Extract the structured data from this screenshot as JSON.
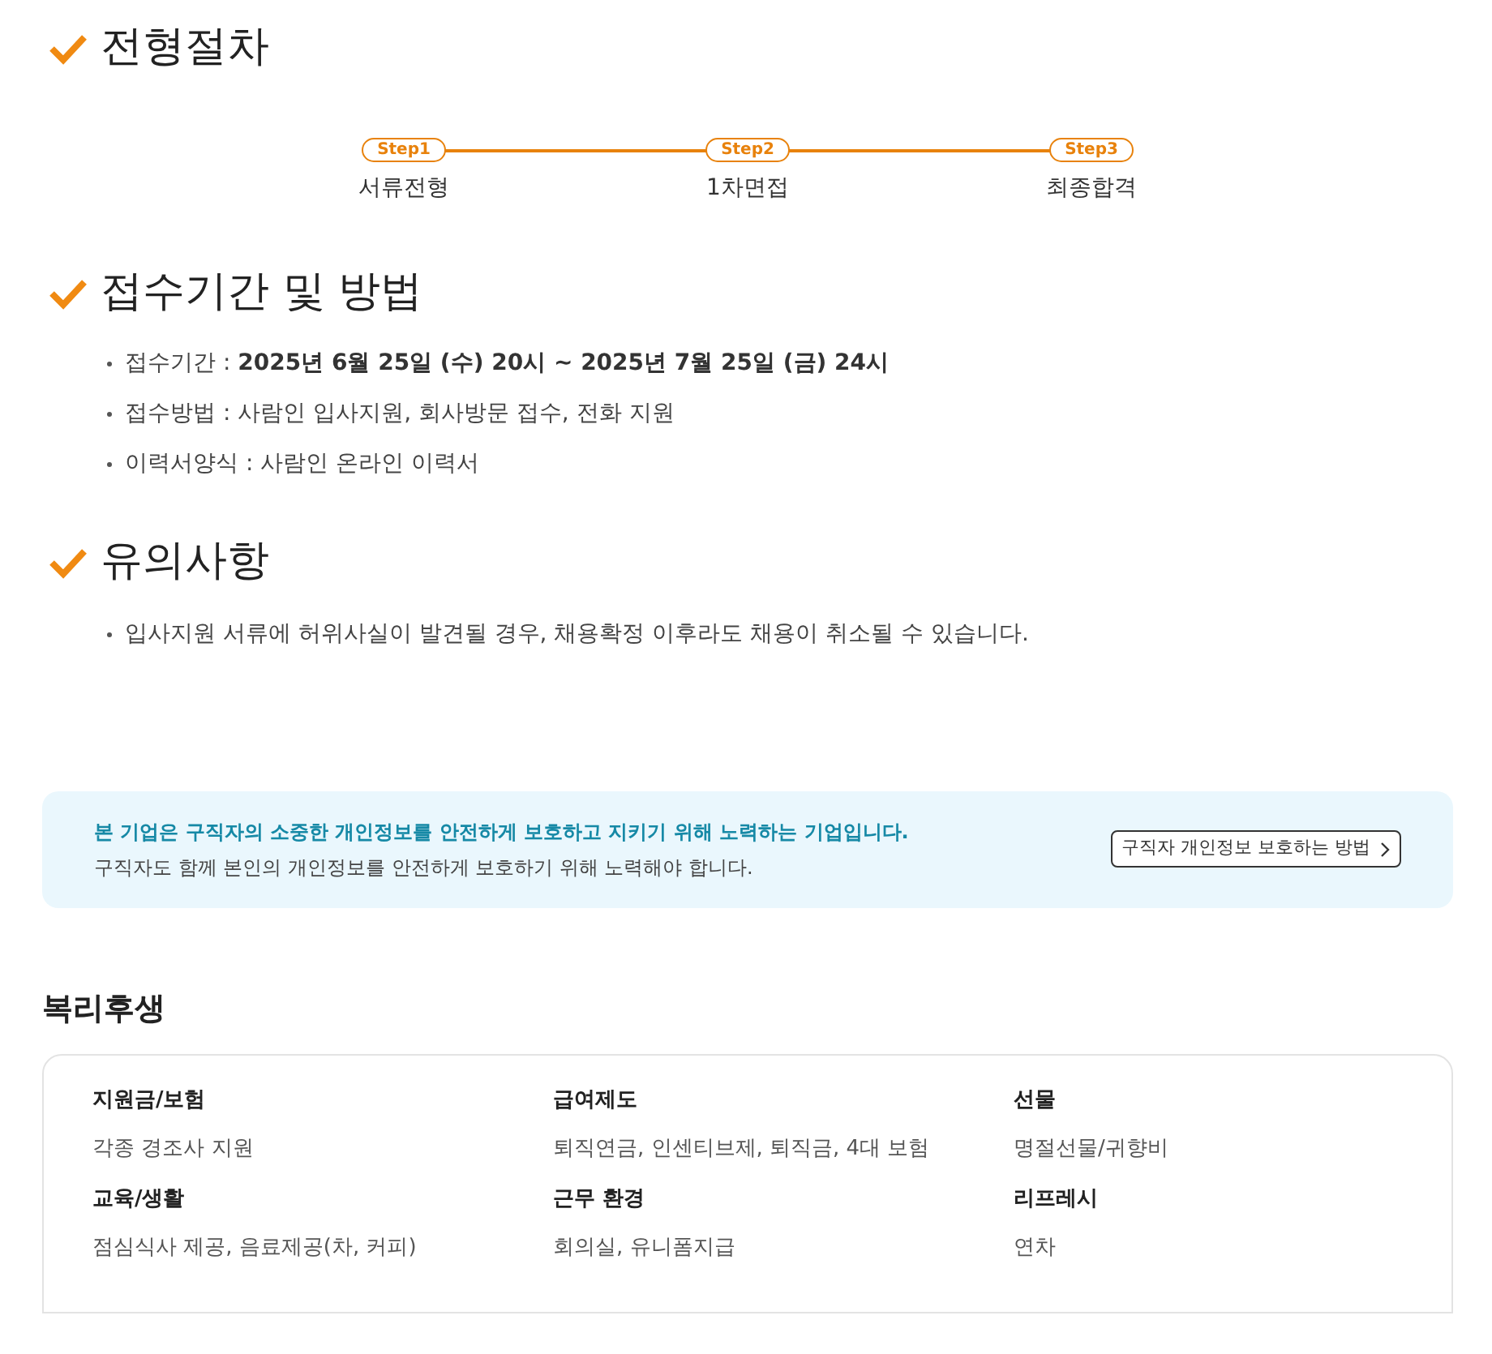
{
  "sections": [
    {
      "title": "전형절차",
      "kind": "steps",
      "steps": [
        {
          "badge": "Step1",
          "label": "서류전형"
        },
        {
          "badge": "Step2",
          "label": "1차면접"
        },
        {
          "badge": "Step3",
          "label": "최종합격"
        }
      ]
    },
    {
      "title": "접수기간 및 방법",
      "kind": "list",
      "items": [
        "접수기간 : **2025년 6월 25일 (수) 20시 ~ 2025년 7월 25일 (금) 24시**",
        "접수방법 : 사람인 입사지원, 회사방문 접수, 전화 지원",
        "이력서양식 : 사람인 온라인 이력서"
      ]
    },
    {
      "title": "유의사항",
      "kind": "list",
      "items": [
        "입사지원 서류에 허위사실이 발견될 경우, 채용확정 이후라도 채용이 취소될 수 있습니다."
      ]
    }
  ],
  "privacy_notice": {
    "headline": "본 기업은 구직자의 소중한 개인정보를 안전하게 보호하고 지키기 위해 노력하는 기업입니다.",
    "body": "구직자도 함께 본인의 개인정보를 안전하게 보호하기 위해 노력해야 합니다.",
    "button": "구직자 개인정보 보호하는 방법"
  },
  "benefits": {
    "title": "복리후생",
    "items": [
      {
        "label": "지원금/보험",
        "value": "각종 경조사 지원"
      },
      {
        "label": "급여제도",
        "value": "퇴직연금, 인센티브제, 퇴직금, 4대 보험"
      },
      {
        "label": "선물",
        "value": "명절선물/귀향비"
      },
      {
        "label": "교육/생활",
        "value": "점심식사 제공, 음료제공(차, 커피)"
      },
      {
        "label": "근무 환경",
        "value": "회의실, 유니폼지급"
      },
      {
        "label": "리프레시",
        "value": "연차"
      }
    ]
  }
}
